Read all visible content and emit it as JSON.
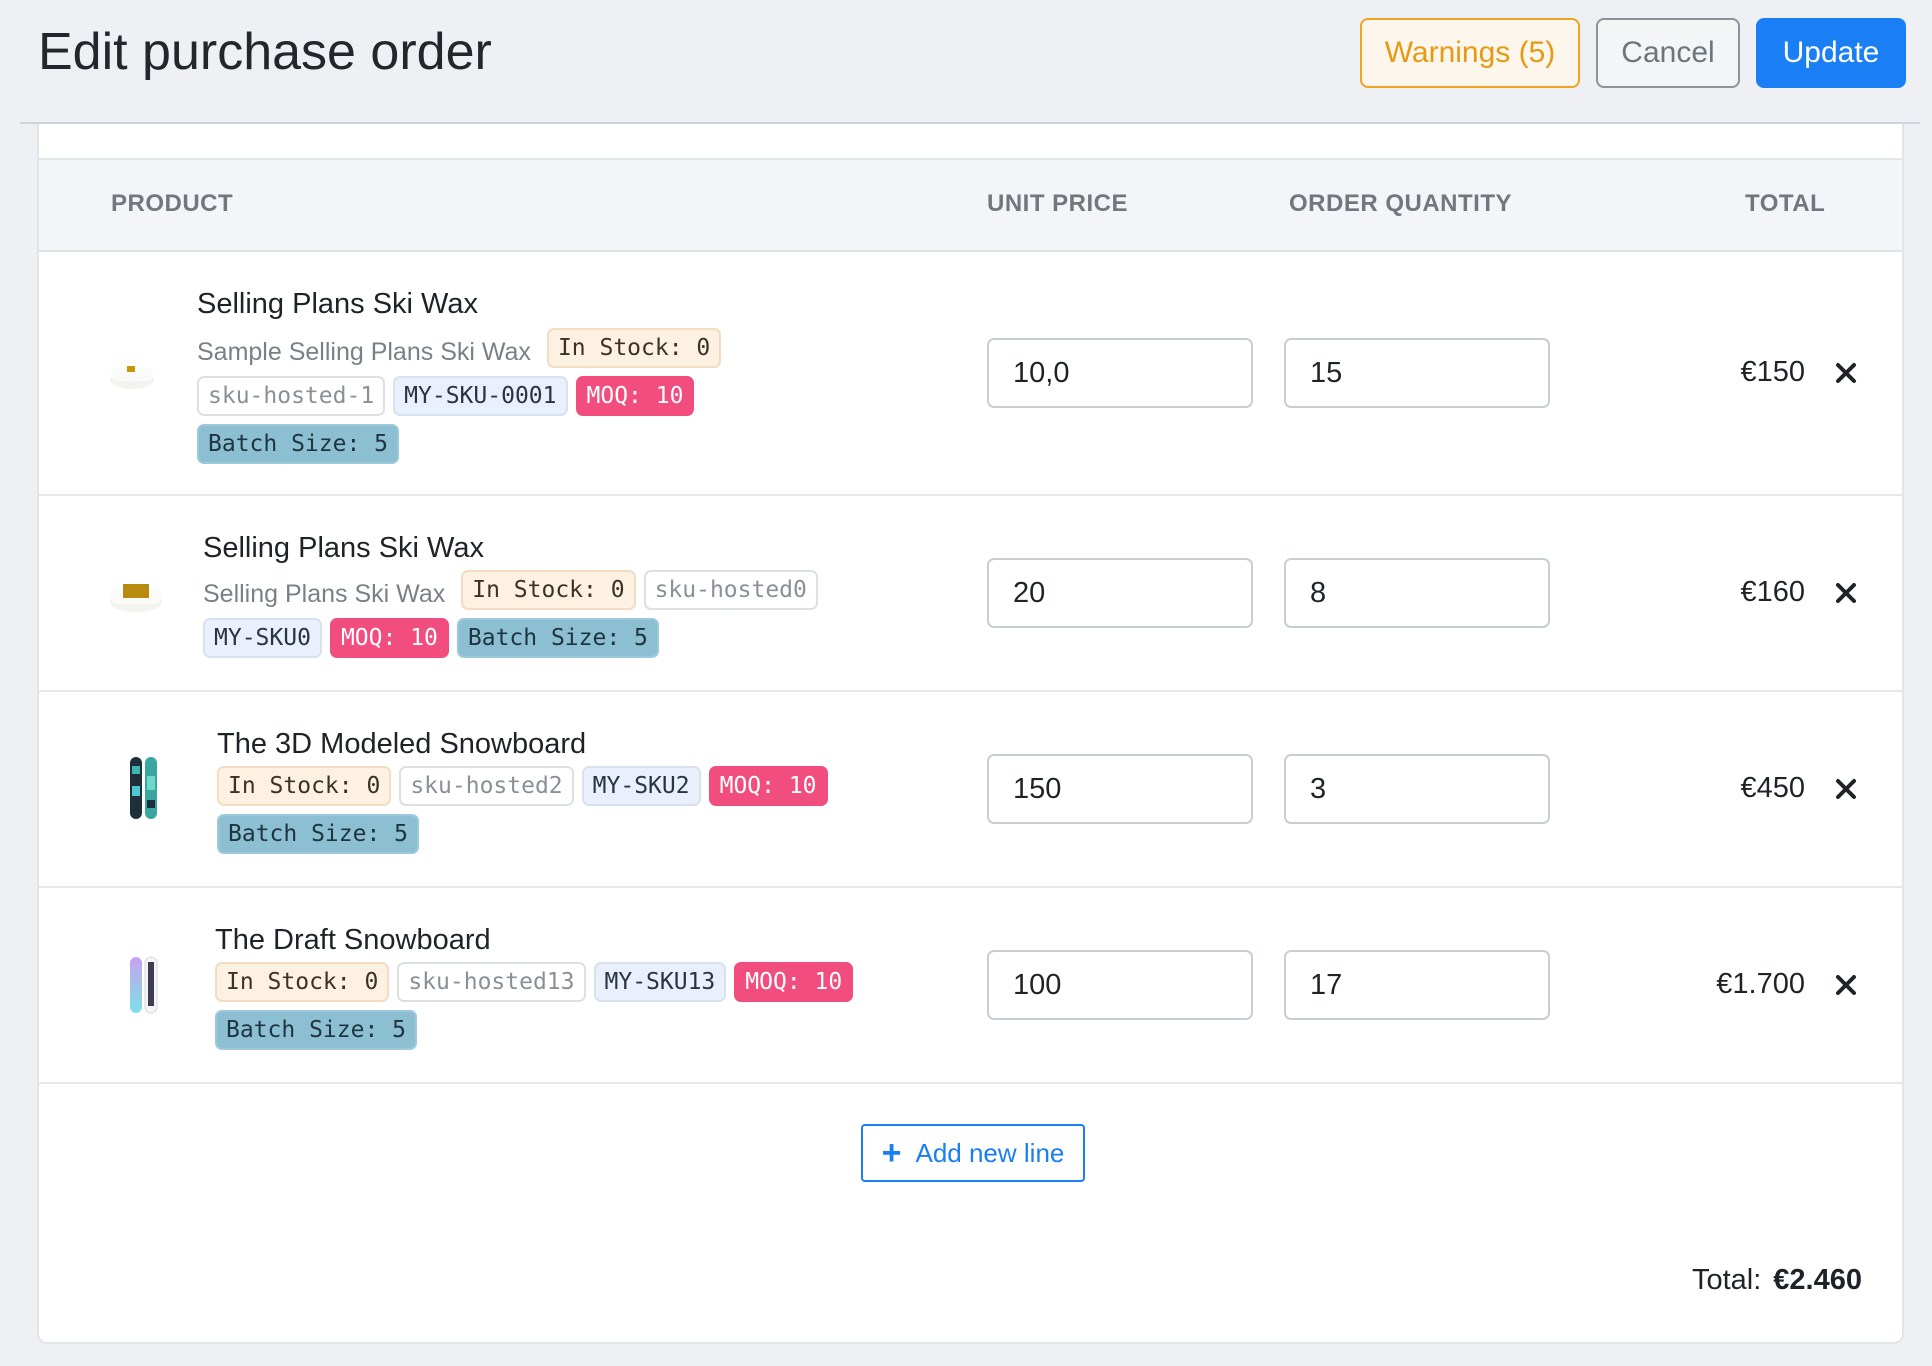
{
  "header": {
    "title": "Edit purchase order",
    "warnings_label": "Warnings (5)",
    "cancel_label": "Cancel",
    "update_label": "Update"
  },
  "table": {
    "columns": {
      "product": "PRODUCT",
      "unit_price": "UNIT PRICE",
      "order_quantity": "ORDER QUANTITY",
      "total": "TOTAL"
    },
    "rows": [
      {
        "name": "Selling Plans Ski Wax",
        "subtitle": "Sample Selling Plans Ski Wax",
        "in_stock": "In Stock: 0",
        "sku_hosted": "sku-hosted-1",
        "sku": "MY-SKU-0001",
        "moq": "MOQ: 10",
        "batch": "Batch Size: 5",
        "unit_price": "10,0",
        "quantity": "15",
        "total": "€150",
        "thumb_icon": "ski-wax-icon"
      },
      {
        "name": "Selling Plans Ski Wax",
        "subtitle": "Selling Plans Ski Wax",
        "in_stock": "In Stock: 0",
        "sku_hosted": "sku-hosted0",
        "sku": "MY-SKU0",
        "moq": "MOQ: 10",
        "batch": "Batch Size: 5",
        "unit_price": "20",
        "quantity": "8",
        "total": "€160",
        "thumb_icon": "ski-wax-icon"
      },
      {
        "name": "The 3D Modeled Snowboard",
        "in_stock": "In Stock: 0",
        "sku_hosted": "sku-hosted2",
        "sku": "MY-SKU2",
        "moq": "MOQ: 10",
        "batch": "Batch Size: 5",
        "unit_price": "150",
        "quantity": "3",
        "total": "€450",
        "thumb_icon": "snowboard-icon"
      },
      {
        "name": "The Draft Snowboard",
        "in_stock": "In Stock: 0",
        "sku_hosted": "sku-hosted13",
        "sku": "MY-SKU13",
        "moq": "MOQ: 10",
        "batch": "Batch Size: 5",
        "unit_price": "100",
        "quantity": "17",
        "total": "€1.700",
        "thumb_icon": "snowboard-icon"
      }
    ]
  },
  "add_line_label": "Add new line",
  "summary": {
    "total_label": "Total:",
    "total_value": "€2.460"
  },
  "colors": {
    "accent": "#1a7ef5",
    "warning": "#f0a422",
    "moq_badge": "#f24d7f",
    "batch_badge": "#8dbfd2"
  }
}
